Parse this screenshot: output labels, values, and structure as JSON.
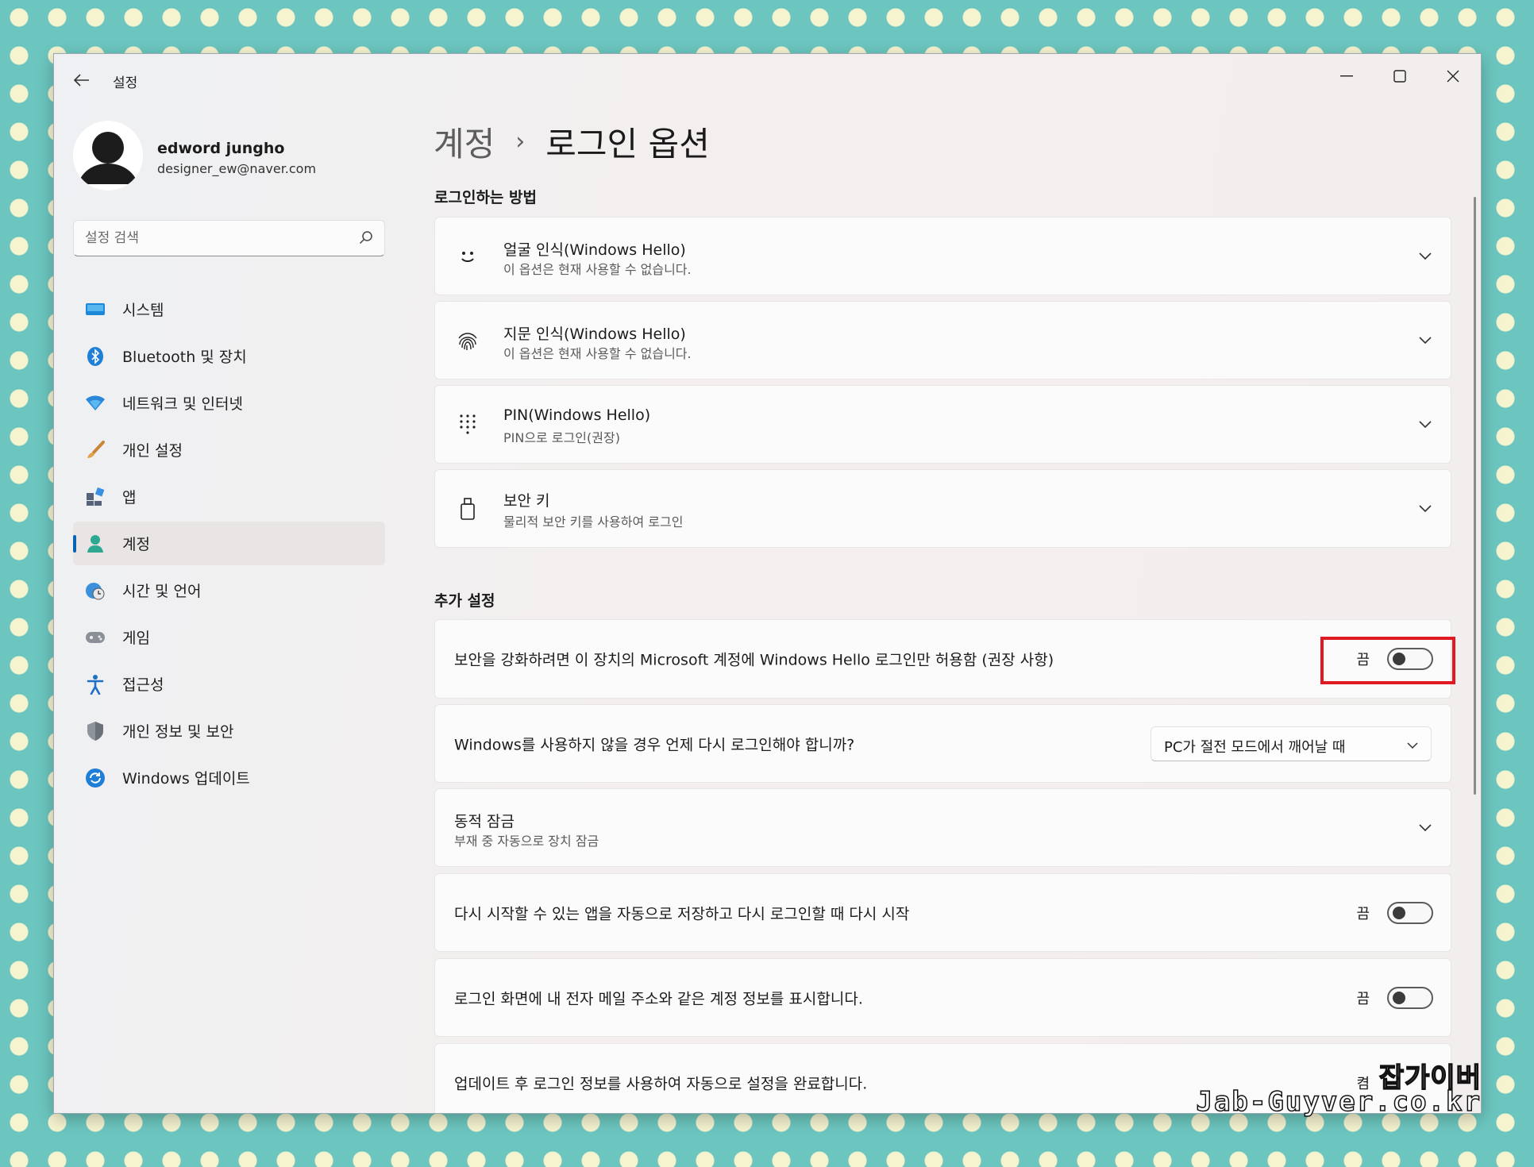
{
  "window": {
    "app_title": "설정"
  },
  "user": {
    "name": "edword jungho",
    "email": "designer_ew@naver.com"
  },
  "search": {
    "placeholder": "설정 검색"
  },
  "sidebar": {
    "items": [
      {
        "label": "시스템",
        "icon": "system-icon"
      },
      {
        "label": "Bluetooth 및 장치",
        "icon": "bluetooth-icon"
      },
      {
        "label": "네트워크 및 인터넷",
        "icon": "wifi-icon"
      },
      {
        "label": "개인 설정",
        "icon": "brush-icon"
      },
      {
        "label": "앱",
        "icon": "apps-icon"
      },
      {
        "label": "계정",
        "icon": "account-icon",
        "active": true
      },
      {
        "label": "시간 및 언어",
        "icon": "globe-clock-icon"
      },
      {
        "label": "게임",
        "icon": "gamepad-icon"
      },
      {
        "label": "접근성",
        "icon": "accessibility-icon"
      },
      {
        "label": "개인 정보 및 보안",
        "icon": "shield-icon"
      },
      {
        "label": "Windows 업데이트",
        "icon": "update-icon"
      }
    ]
  },
  "breadcrumb": {
    "parent": "계정",
    "separator": "›",
    "current": "로그인 옵션"
  },
  "signin_methods": {
    "title": "로그인하는 방법",
    "items": [
      {
        "title": "얼굴 인식(Windows Hello)",
        "subtitle": "이 옵션은 현재 사용할 수 없습니다.",
        "icon": "face-icon"
      },
      {
        "title": "지문 인식(Windows Hello)",
        "subtitle": "이 옵션은 현재 사용할 수 없습니다.",
        "icon": "fingerprint-icon"
      },
      {
        "title": "PIN(Windows Hello)",
        "subtitle": "PIN으로 로그인(권장)",
        "icon": "pin-keypad-icon"
      },
      {
        "title": "보안 키",
        "subtitle": "물리적 보안 키를 사용하여 로그인",
        "icon": "security-key-icon"
      }
    ]
  },
  "additional": {
    "title": "추가 설정",
    "hello_only": {
      "label": "보안을 강화하려면 이 장치의 Microsoft 계정에 Windows Hello 로그인만 허용함 (권장 사항)",
      "state": "끔",
      "on": false
    },
    "require_signin": {
      "label": "Windows를 사용하지 않을 경우 언제 다시 로그인해야 합니까?",
      "value": "PC가 절전 모드에서 깨어날 때"
    },
    "dynamic_lock": {
      "title": "동적 잠금",
      "subtitle": "부재 중 자동으로 장치 잠금"
    },
    "restart_apps": {
      "label": "다시 시작할 수 있는 앱을 자동으로 저장하고 다시 로그인할 때 다시 시작",
      "state": "끔",
      "on": false
    },
    "show_account": {
      "label": "로그인 화면에 내 전자 메일 주소와 같은 계정 정보를 표시합니다.",
      "state": "끔",
      "on": false
    },
    "auto_finish": {
      "label": "업데이트 후 로그인 정보를 사용하여 자동으로 설정을 완료합니다.",
      "state": "켬"
    }
  },
  "watermark": {
    "korean": "잡가이버",
    "url": "Jab-Guyver.co.kr"
  },
  "colors": {
    "accent": "#0a64b6",
    "highlight": "#e01a22",
    "background": "#6cc6bf"
  }
}
